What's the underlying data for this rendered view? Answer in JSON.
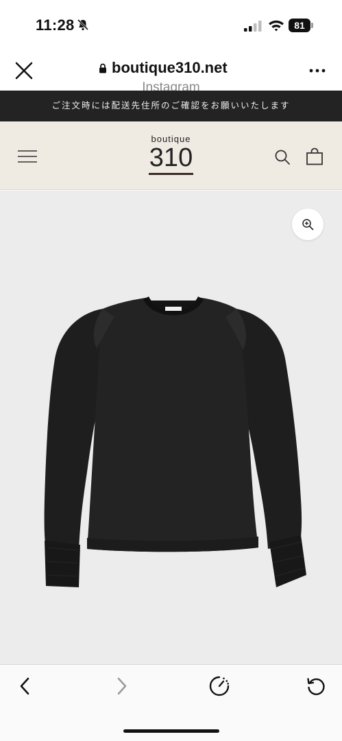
{
  "status_bar": {
    "time": "11:28",
    "battery": "81"
  },
  "browser": {
    "url": "boutique310.net",
    "source_label": "Instagram"
  },
  "notice": {
    "text": "ご注文時には配送先住所のご確認をお願いいたします"
  },
  "site": {
    "logo_small": "boutique",
    "logo_big": "310"
  },
  "colors": {
    "notice_bg": "#232323",
    "header_bg": "#efeae2",
    "logo_underline": "#3a2a25",
    "product_bg": "#ececec"
  },
  "icons": {
    "status": [
      "bell-slash-icon",
      "signal-icon",
      "wifi-icon"
    ],
    "browser": [
      "close-icon",
      "lock-icon",
      "more-icon"
    ],
    "site": [
      "menu-icon",
      "search-icon",
      "bag-icon",
      "zoom-icon"
    ],
    "toolbar": [
      "chevron-left-icon",
      "chevron-right-icon",
      "speedometer-icon",
      "reload-icon"
    ]
  }
}
